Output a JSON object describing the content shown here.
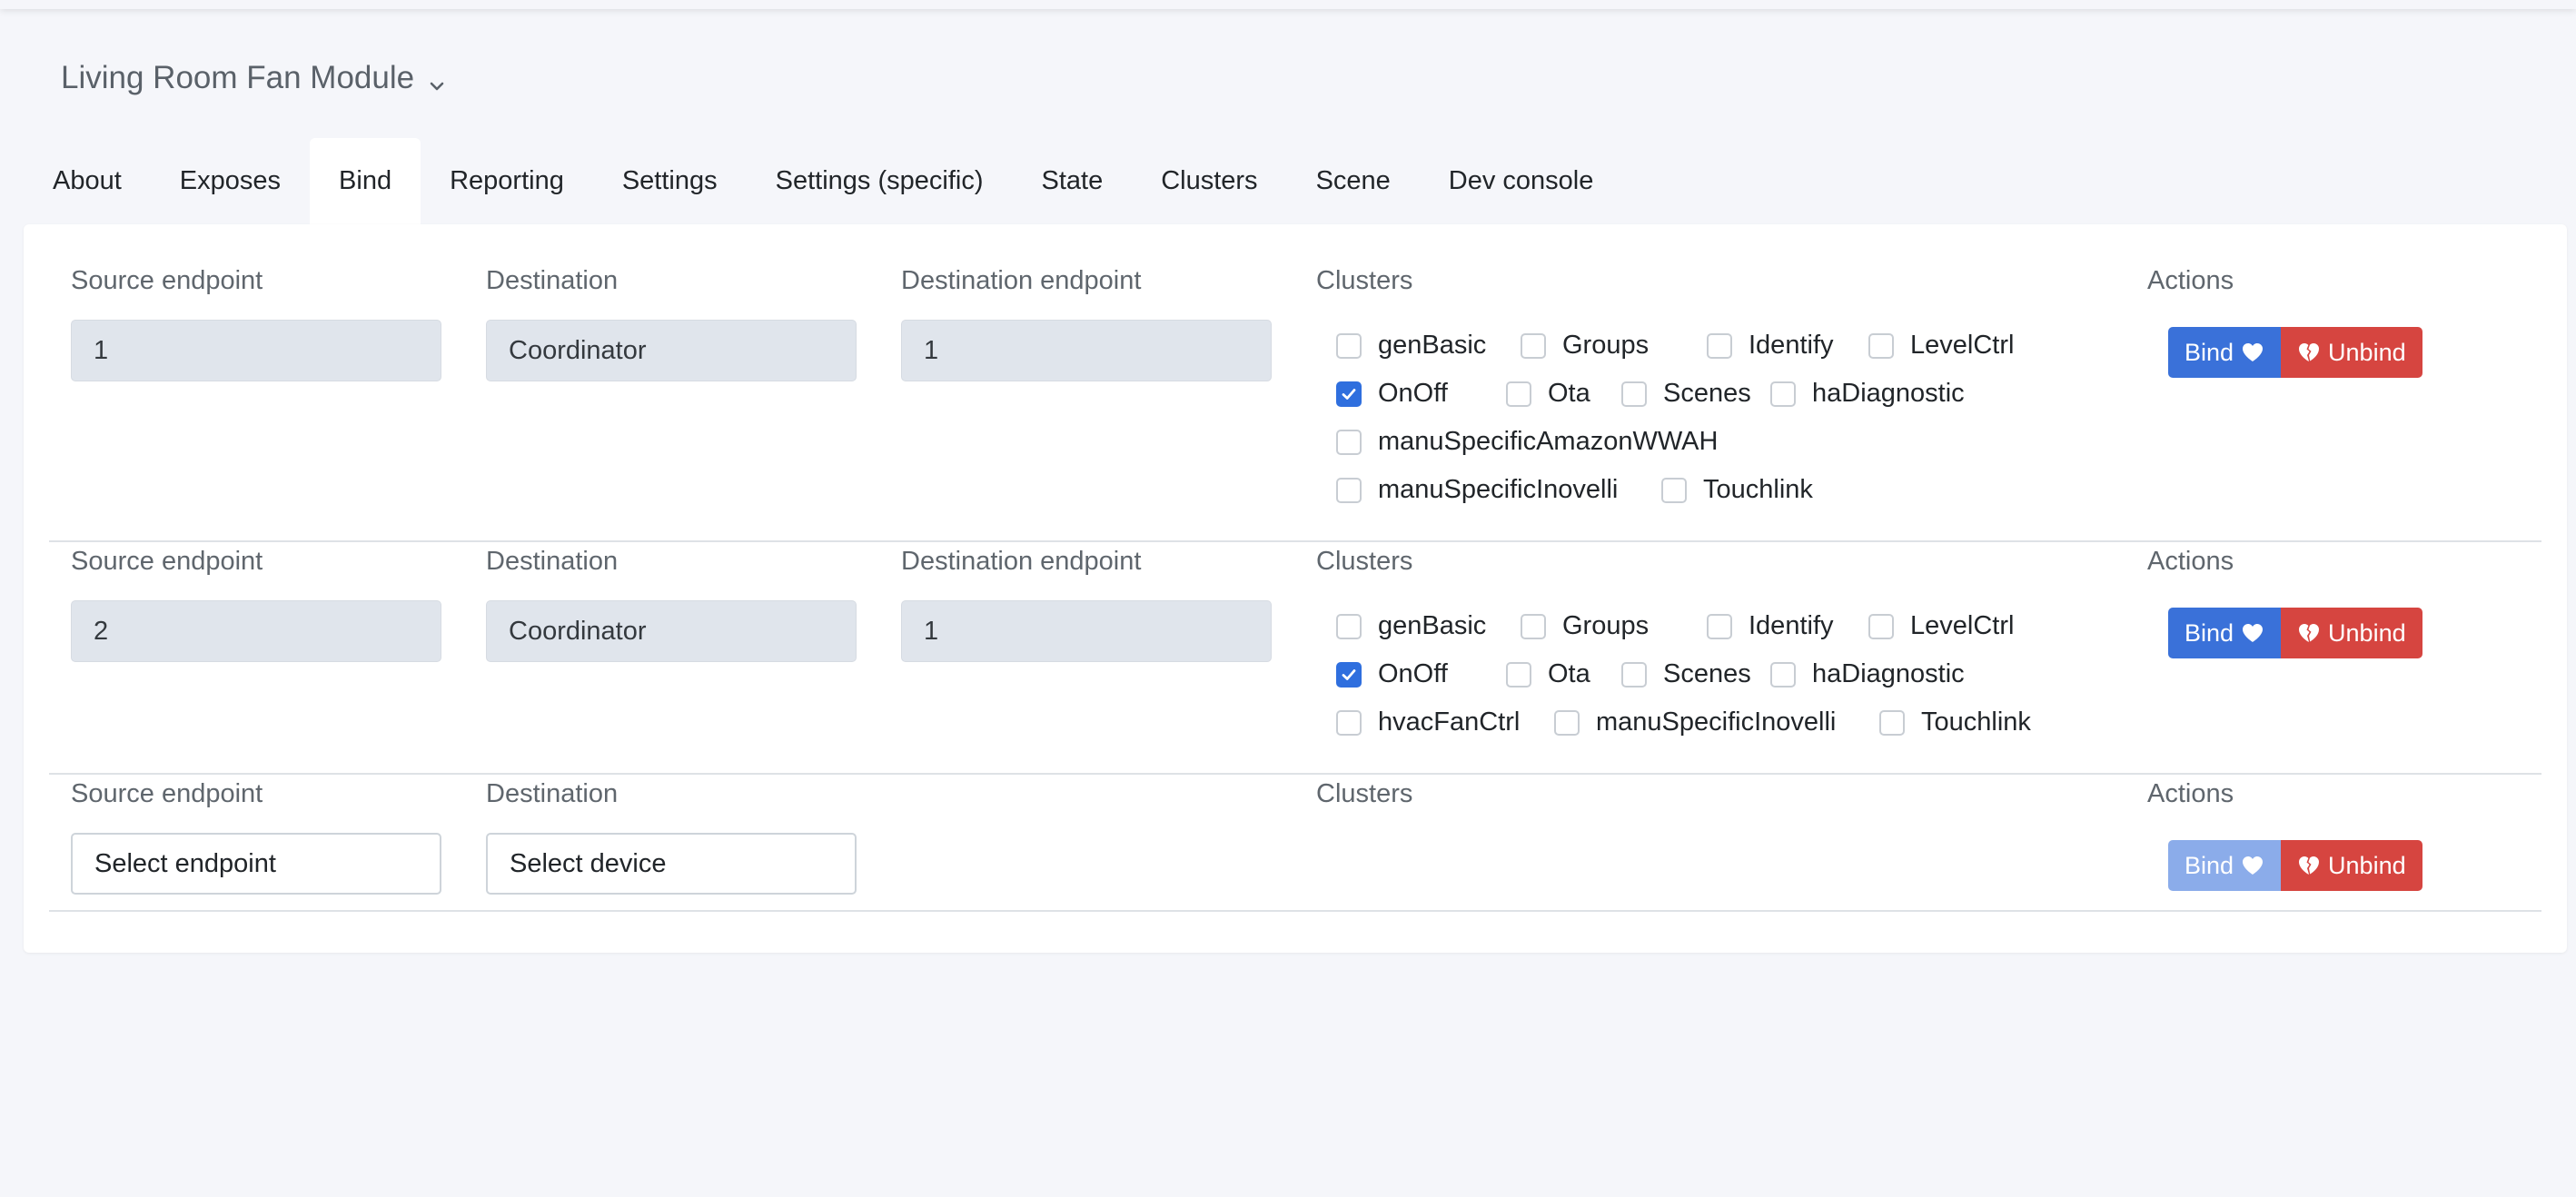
{
  "device": {
    "title": "Living Room Fan Module"
  },
  "tabs": [
    {
      "label": "About"
    },
    {
      "label": "Exposes"
    },
    {
      "label": "Bind",
      "active": true
    },
    {
      "label": "Reporting"
    },
    {
      "label": "Settings"
    },
    {
      "label": "Settings (specific)"
    },
    {
      "label": "State"
    },
    {
      "label": "Clusters"
    },
    {
      "label": "Scene"
    },
    {
      "label": "Dev console"
    }
  ],
  "labels": {
    "source_endpoint": "Source endpoint",
    "destination": "Destination",
    "destination_endpoint": "Destination endpoint",
    "clusters": "Clusters",
    "actions": "Actions",
    "bind": "Bind",
    "unbind": "Unbind"
  },
  "rows": [
    {
      "source_endpoint": "1",
      "destination": "Coordinator",
      "destination_endpoint": "1",
      "clusters": [
        {
          "name": "genBasic",
          "checked": false
        },
        {
          "name": "Groups",
          "checked": false
        },
        {
          "name": "Identify",
          "checked": false
        },
        {
          "name": "LevelCtrl",
          "checked": false
        },
        {
          "name": "OnOff",
          "checked": true
        },
        {
          "name": "Ota",
          "checked": false
        },
        {
          "name": "Scenes",
          "checked": false
        },
        {
          "name": "haDiagnostic",
          "checked": false
        },
        {
          "name": "manuSpecificAmazonWWAH",
          "checked": false
        },
        {
          "name": "manuSpecificInovelli",
          "checked": false
        },
        {
          "name": "Touchlink",
          "checked": false
        }
      ]
    },
    {
      "source_endpoint": "2",
      "destination": "Coordinator",
      "destination_endpoint": "1",
      "clusters": [
        {
          "name": "genBasic",
          "checked": false
        },
        {
          "name": "Groups",
          "checked": false
        },
        {
          "name": "Identify",
          "checked": false
        },
        {
          "name": "LevelCtrl",
          "checked": false
        },
        {
          "name": "OnOff",
          "checked": true
        },
        {
          "name": "Ota",
          "checked": false
        },
        {
          "name": "Scenes",
          "checked": false
        },
        {
          "name": "haDiagnostic",
          "checked": false
        },
        {
          "name": "hvacFanCtrl",
          "checked": false
        },
        {
          "name": "manuSpecificInovelli",
          "checked": false
        },
        {
          "name": "Touchlink",
          "checked": false
        }
      ]
    },
    {
      "source_endpoint": "Select endpoint",
      "destination": "Select device",
      "bind_disabled": true
    }
  ],
  "colors": {
    "bind": "#3a71d9",
    "bind_disabled": "#8bacea",
    "unbind": "#d64540",
    "checked": "#2f6fde"
  }
}
